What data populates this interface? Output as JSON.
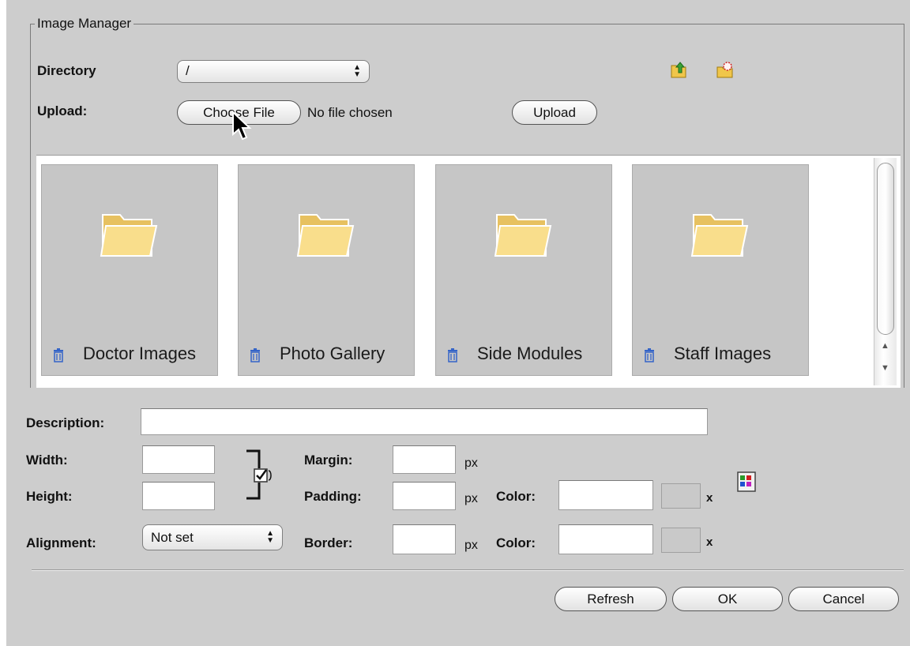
{
  "dialog": {
    "title": "Image Manager"
  },
  "toolbar": {
    "directory_label": "Directory",
    "directory_value": "/",
    "upload_label": "Upload:",
    "choose_file_label": "Choose File",
    "no_file_text": "No file chosen",
    "upload_button": "Upload",
    "icons": [
      "folder-up-icon",
      "new-folder-icon"
    ]
  },
  "browser": {
    "folders": [
      {
        "name": "Doctor Images"
      },
      {
        "name": "Photo Gallery"
      },
      {
        "name": "Side Modules"
      },
      {
        "name": "Staff Images"
      }
    ]
  },
  "properties": {
    "description_label": "Description:",
    "description_value": "",
    "width_label": "Width:",
    "width_value": "",
    "height_label": "Height:",
    "height_value": "",
    "constrain_proportions": true,
    "alignment_label": "Alignment:",
    "alignment_value": "Not set",
    "margin_label": "Margin:",
    "margin_value": "",
    "padding_label": "Padding:",
    "padding_value": "",
    "border_label": "Border:",
    "border_value": "",
    "px_unit": "px",
    "color_label": "Color:",
    "padding_color_value": "",
    "border_color_value": "",
    "clear_mark": "x"
  },
  "footer": {
    "refresh_button": "Refresh",
    "ok_button": "OK",
    "cancel_button": "Cancel"
  },
  "colors": {
    "dialog_bg": "#cdcdcd",
    "tile_bg": "#c6c6c6",
    "folder_yellow": "#f6d77a",
    "trash_blue": "#3464c8"
  }
}
